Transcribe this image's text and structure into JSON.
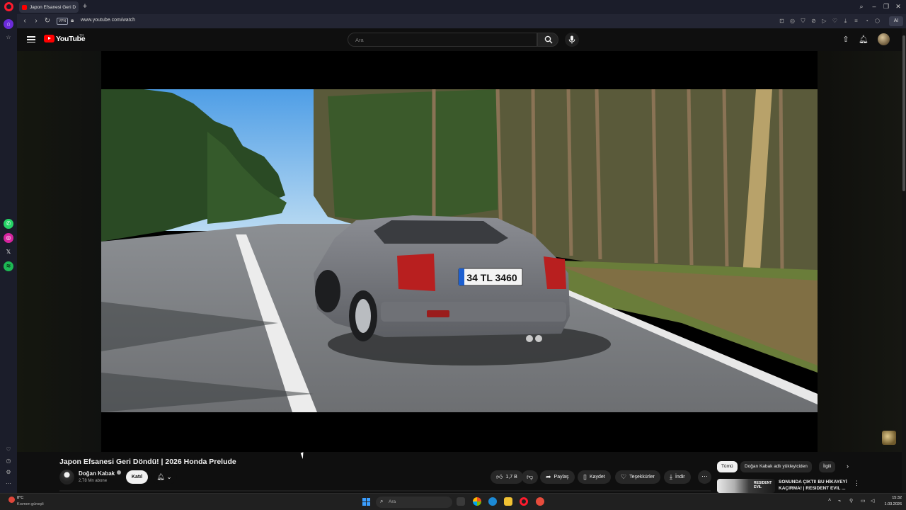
{
  "browser": {
    "tab_title": "Japon Efsanesi Geri D",
    "url": "www.youtube.com/watch",
    "vpn_label": "VPN",
    "ai_label": "AI"
  },
  "youtube": {
    "logo_text": "YouTube",
    "country_code": "TR",
    "search_placeholder": "Ara"
  },
  "video": {
    "title": "Japon Efsanesi Geri Döndü! | 2026 Honda Prelude",
    "plate_text": "34 TL 3460",
    "channel_name": "Doğan Kabak",
    "subscribers": "2,78 Mn abone",
    "join_label": "Katıl",
    "likes": "1,7 B",
    "share_label": "Paylaş",
    "save_label": "Kaydet",
    "thanks_label": "Teşekkürler",
    "download_label": "İndir"
  },
  "recommendations": {
    "chips": [
      "Tümü",
      "Doğan Kabak adlı yükleyiciden",
      "İlgili"
    ],
    "items": [
      {
        "thumb_text": "RESIDENT EVIL",
        "title": "SONUNDA ÇIKTI! BU HİKAYEYİ KAÇIRMA! | RESIDENT EVIL ..."
      }
    ]
  },
  "taskbar": {
    "weather_temp": "8°C",
    "weather_desc": "Kısmen güneşli",
    "search_placeholder": "Ara",
    "time": "15:32",
    "date": "1.03.2026"
  },
  "colors": {
    "accent": "#ff0000",
    "opera": "#ff1b2d",
    "background": "#0f0f0f"
  }
}
